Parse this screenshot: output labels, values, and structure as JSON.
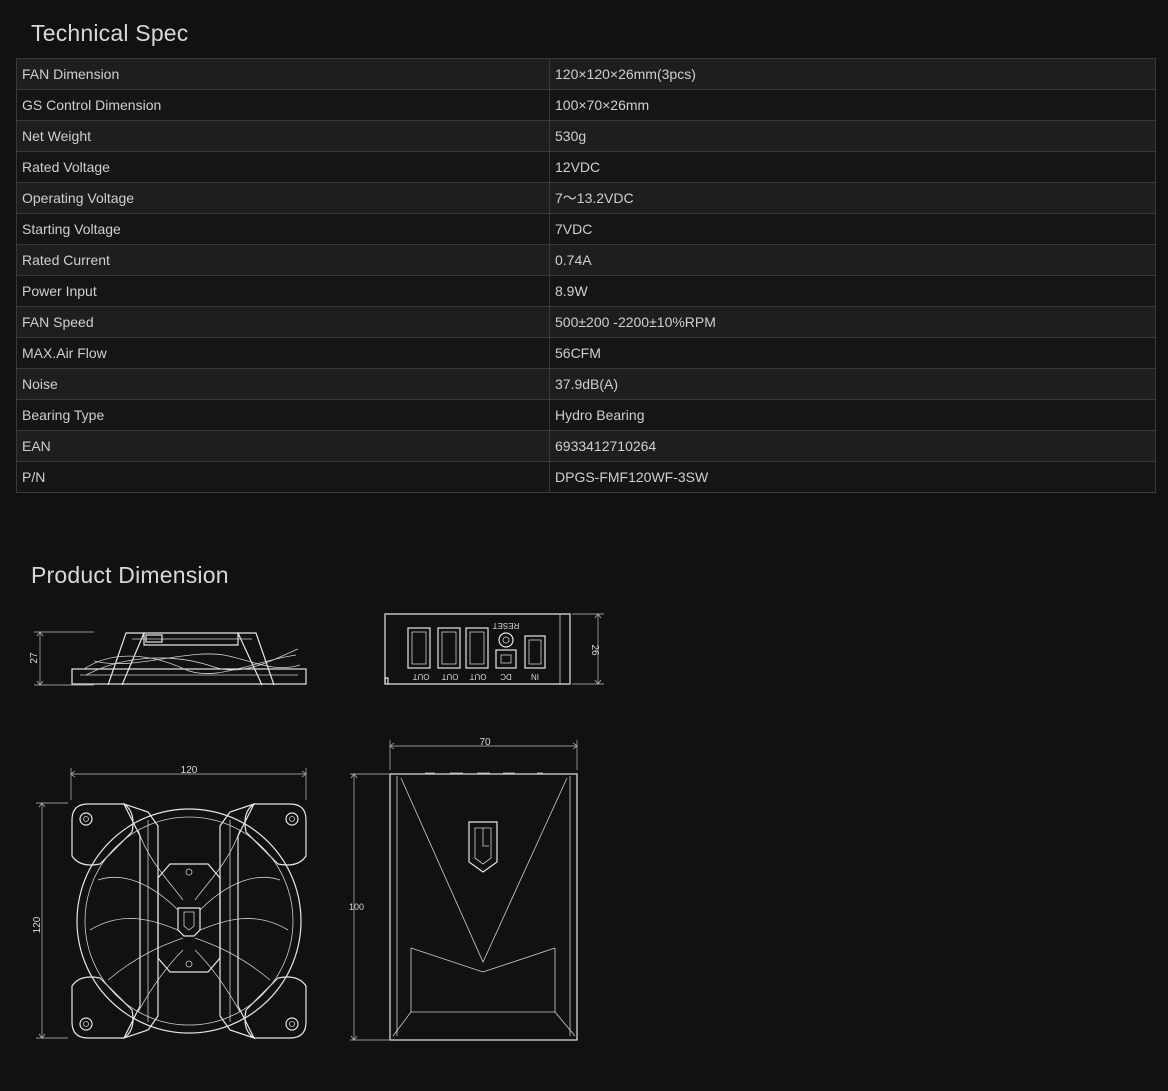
{
  "spec": {
    "title": "Technical Spec",
    "rows": [
      {
        "label": "FAN Dimension",
        "value": "120×120×26mm(3pcs)"
      },
      {
        "label": "GS Control Dimension",
        "value": "100×70×26mm"
      },
      {
        "label": "Net Weight",
        "value": "530g"
      },
      {
        "label": "Rated Voltage",
        "value": "12VDC"
      },
      {
        "label": "Operating Voltage",
        "value": "7～13.2VDC"
      },
      {
        "label": "Starting Voltage",
        "value": "7VDC"
      },
      {
        "label": "Rated Current",
        "value": "0.74A"
      },
      {
        "label": "Power Input",
        "value": "8.9W"
      },
      {
        "label": "FAN Speed",
        "value": "500±200 -2200±10%RPM"
      },
      {
        "label": "MAX.Air Flow",
        "value": "56CFM"
      },
      {
        "label": "Noise",
        "value": "37.9dB(A)"
      },
      {
        "label": "Bearing Type",
        "value": "Hydro Bearing"
      },
      {
        "label": "EAN",
        "value": "6933412710264"
      },
      {
        "label": "P/N",
        "value": "DPGS-FMF120WF-3SW"
      }
    ]
  },
  "dimension": {
    "title": "Product Dimension",
    "fan_side": {
      "height_label": "27"
    },
    "controller_side": {
      "height_label": "26",
      "reset_label": "RESET",
      "port_labels": [
        "OUT",
        "OUT",
        "OUT",
        "DC",
        "IN"
      ]
    },
    "fan_front": {
      "width_label": "120",
      "height_label": "120"
    },
    "controller_front": {
      "width_label": "70",
      "height_label": "100"
    }
  }
}
